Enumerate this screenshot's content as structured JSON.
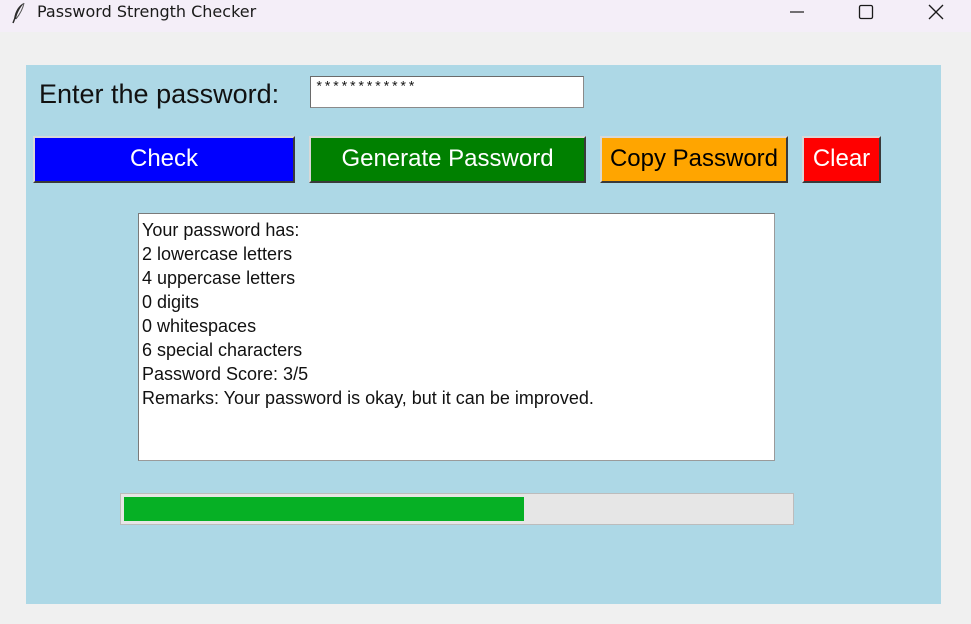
{
  "window": {
    "title": "Password Strength Checker",
    "icon": "feather-icon",
    "controls": [
      "minimize-icon",
      "maximize-icon",
      "close-icon"
    ]
  },
  "form": {
    "password_label": "Enter the password:",
    "password_value": "************"
  },
  "buttons": {
    "check": "Check",
    "generate": "Generate Password",
    "copy": "Copy Password",
    "clear": "Clear"
  },
  "result": {
    "lines": [
      "Your password has:",
      "2 lowercase letters",
      "4 uppercase letters",
      "0 digits",
      "0 whitespaces",
      "6 special characters",
      "Password Score: 3/5",
      "Remarks: Your password is okay, but it can be improved."
    ]
  },
  "strength": {
    "score": 3,
    "max_score": 5,
    "fill_color": "#06b025"
  },
  "colors": {
    "panel_background": "#add8e6",
    "check_button": "#0000ff",
    "generate_button": "#008000",
    "copy_button": "#ffa500",
    "clear_button": "#ff0000"
  }
}
